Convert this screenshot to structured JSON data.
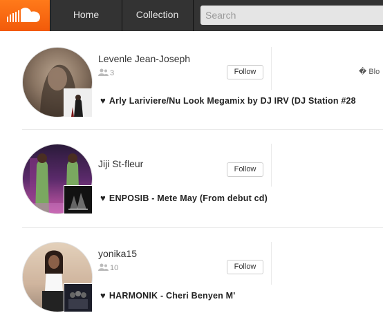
{
  "nav": {
    "home": "Home",
    "collection": "Collection",
    "search_placeholder": "Search",
    "brand_color": "#ff5500"
  },
  "block_label": "� Blo",
  "users": [
    {
      "name": "Levenle Jean-Joseph",
      "followers": "3",
      "follow_label": "Follow",
      "track": "Arly Lariviere/Nu Look Megamix by DJ IRV (DJ Station #28",
      "heart_icon": "heart-icon"
    },
    {
      "name": "Jiji St-fleur",
      "followers": "",
      "follow_label": "Follow",
      "track": "ENPOSIB - Mete May (From debut cd)",
      "heart_icon": "heart-icon"
    },
    {
      "name": "yonika15",
      "followers": "10",
      "follow_label": "Follow",
      "track": "HARMONIK - Cheri Benyen M'",
      "heart_icon": "heart-icon"
    }
  ]
}
